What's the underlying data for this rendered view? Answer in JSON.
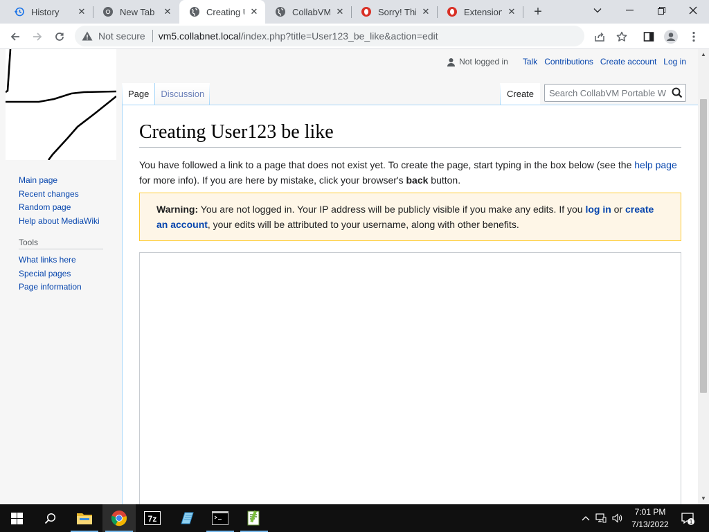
{
  "browser": {
    "tabs": [
      {
        "title": "History",
        "icon": "history-icon",
        "active": false
      },
      {
        "title": "New Tab",
        "icon": "chrome-icon",
        "active": false
      },
      {
        "title": "Creating U",
        "icon": "globe-icon",
        "active": true
      },
      {
        "title": "CollabVM I",
        "icon": "globe-icon",
        "active": false
      },
      {
        "title": "Sorry! This",
        "icon": "opera-icon",
        "active": false
      },
      {
        "title": "Extension:C",
        "icon": "opera-icon",
        "active": false
      }
    ],
    "security_label": "Not secure",
    "url_host": "vm5.collabnet.local",
    "url_path": "/index.php?title=User123_be_like&action=edit"
  },
  "personal": {
    "anon": "Not logged in",
    "links": [
      "Talk",
      "Contributions",
      "Create account",
      "Log in"
    ]
  },
  "namespaces": {
    "page": "Page",
    "discussion": "Discussion"
  },
  "views": {
    "create": "Create"
  },
  "search": {
    "placeholder": "Search CollabVM Portable W"
  },
  "sidebar": {
    "nav": [
      "Main page",
      "Recent changes",
      "Random page",
      "Help about MediaWiki"
    ],
    "tools_heading": "Tools",
    "tools": [
      "What links here",
      "Special pages",
      "Page information"
    ]
  },
  "content": {
    "title": "Creating User123 be like",
    "intro_1": "You have followed a link to a page that does not exist yet. To create the page, start typing in the box below (see the ",
    "intro_link": "help page",
    "intro_2": " for more info). If you are here by mistake, click your browser's ",
    "intro_bold": "back",
    "intro_3": " button.",
    "warning_label": "Warning:",
    "warning_1": " You are not logged in. Your IP address will be publicly visible if you make any edits. If you ",
    "warning_login": "log in",
    "warning_2": " or ",
    "warning_create": "create an account",
    "warning_3": ", your edits will be attributed to your username, along with other benefits.",
    "editor_text": ""
  },
  "taskbar": {
    "time": "7:01 PM",
    "date": "7/13/2022",
    "notifications": "1"
  },
  "colors": {
    "link": "#0645ad",
    "warning_bg": "#fef6e7",
    "warning_border": "#ffcc33"
  }
}
